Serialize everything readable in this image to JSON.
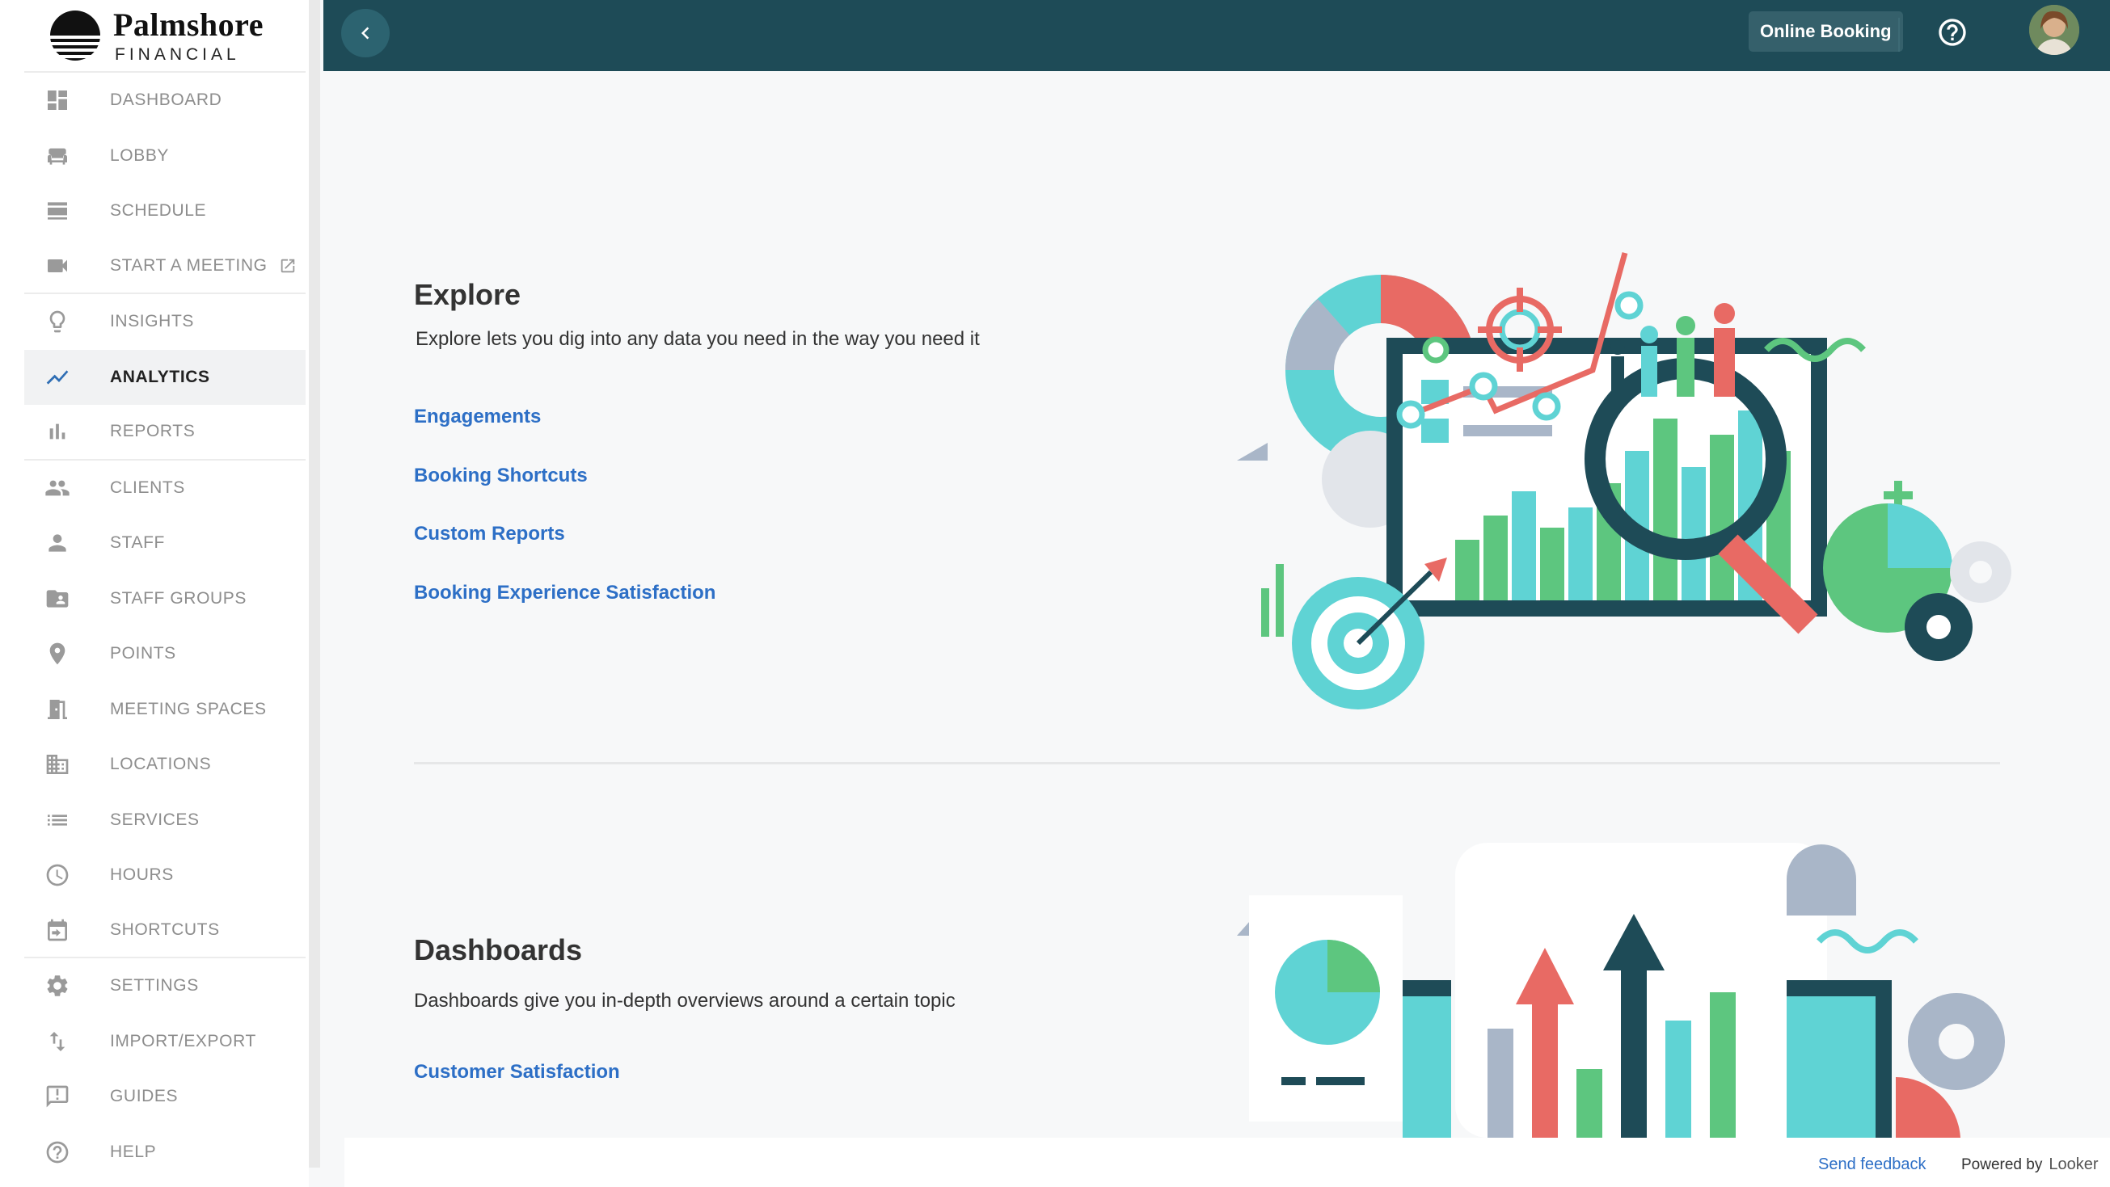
{
  "brand": {
    "name": "Palmshore",
    "subtitle": "FINANCIAL"
  },
  "nav": [
    {
      "label": "DASHBOARD",
      "icon": "dashboard-icon"
    },
    {
      "label": "LOBBY",
      "icon": "sofa-icon"
    },
    {
      "label": "SCHEDULE",
      "icon": "schedule-icon"
    },
    {
      "label": "START A MEETING",
      "icon": "video-camera-icon",
      "external": true
    },
    {
      "label": "INSIGHTS",
      "icon": "lightbulb-icon"
    },
    {
      "label": "ANALYTICS",
      "icon": "analytics-icon",
      "active": true
    },
    {
      "label": "REPORTS",
      "icon": "bar-chart-icon"
    },
    {
      "label": "CLIENTS",
      "icon": "people-icon"
    },
    {
      "label": "STAFF",
      "icon": "person-icon"
    },
    {
      "label": "STAFF GROUPS",
      "icon": "group-folder-icon"
    },
    {
      "label": "POINTS",
      "icon": "location-pin-icon"
    },
    {
      "label": "MEETING SPACES",
      "icon": "door-icon"
    },
    {
      "label": "LOCATIONS",
      "icon": "building-icon"
    },
    {
      "label": "SERVICES",
      "icon": "list-icon"
    },
    {
      "label": "HOURS",
      "icon": "clock-icon"
    },
    {
      "label": "SHORTCUTS",
      "icon": "calendar-shortcut-icon"
    },
    {
      "label": "SETTINGS",
      "icon": "gear-icon"
    },
    {
      "label": "IMPORT/EXPORT",
      "icon": "import-export-icon"
    },
    {
      "label": "GUIDES",
      "icon": "guide-icon"
    },
    {
      "label": "HELP",
      "icon": "help-circle-icon"
    }
  ],
  "topbar": {
    "online_booking": "Online Booking"
  },
  "explore": {
    "title": "Explore",
    "description": "Explore lets you dig into any data you need in the way you need it",
    "links": [
      "Engagements",
      "Booking Shortcuts",
      "Custom Reports",
      "Booking Experience Satisfaction"
    ]
  },
  "dashboards": {
    "title": "Dashboards",
    "description": "Dashboards give you in-depth overviews around a certain topic",
    "links": [
      "Customer Satisfaction"
    ]
  },
  "footer": {
    "send_feedback": "Send feedback",
    "powered_by": "Powered by",
    "looker": "Looker"
  },
  "colors": {
    "topbar": "#1e4b57",
    "teal": "#5fd3d4",
    "green": "#5dc67f",
    "coral": "#e86a64",
    "link": "#2d6fc6"
  }
}
